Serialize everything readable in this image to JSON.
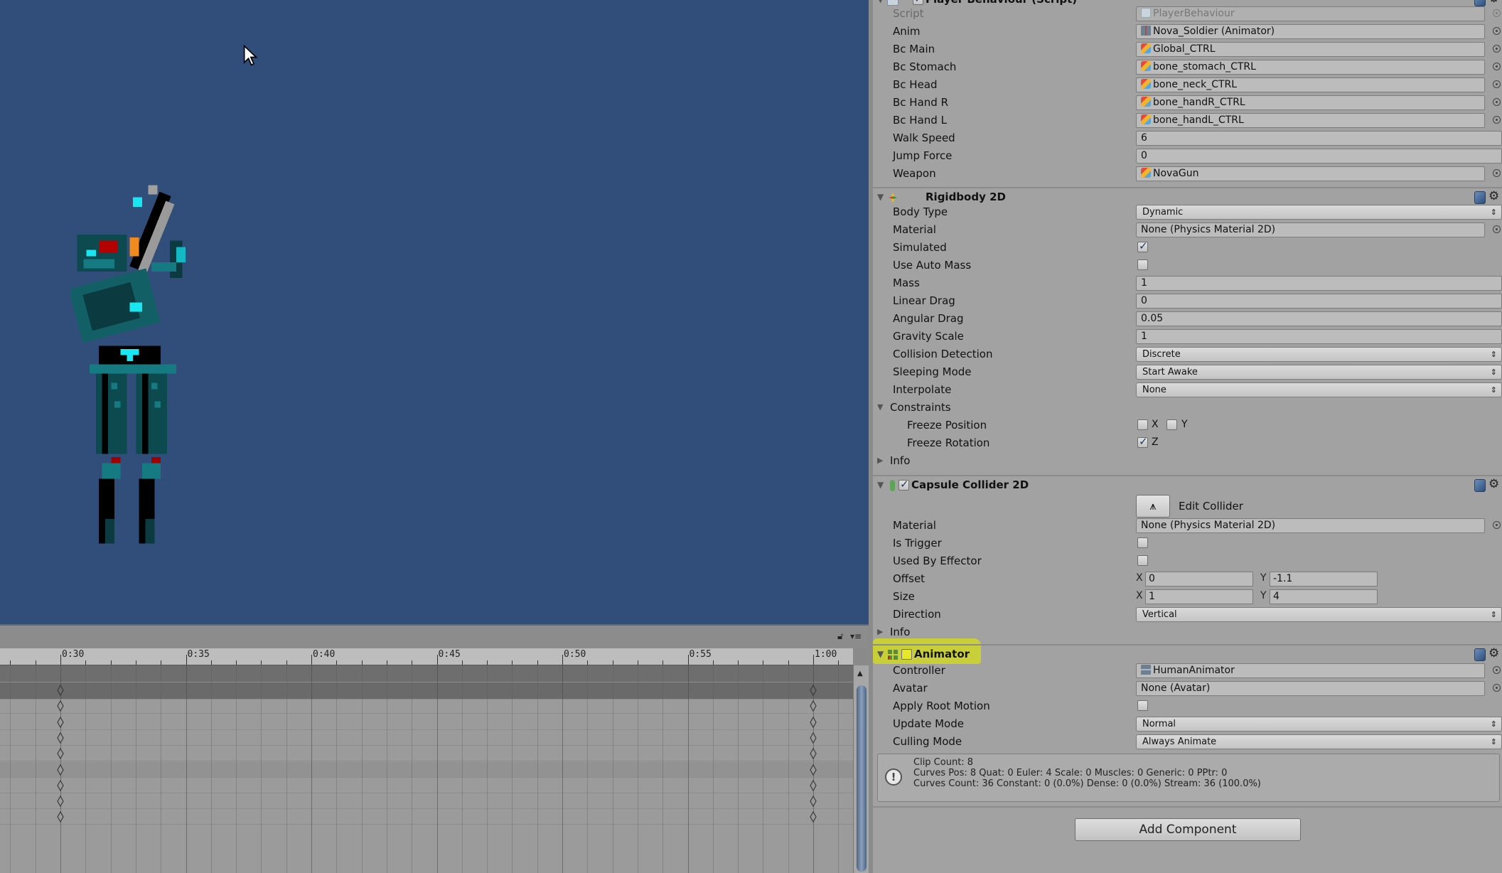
{
  "scene": {
    "background": "#304e79",
    "character": "Nova Soldier pixel sprite holding gun"
  },
  "timeline": {
    "ruler_labels": [
      "0:30",
      "0:35",
      "0:40",
      "0:45",
      "0:50",
      "0:55",
      "1:00"
    ],
    "keyframe_times": [
      "0:30",
      "1:00"
    ],
    "keyframe_rows": 9
  },
  "inspector": {
    "player_behaviour": {
      "title": "Player Behaviour (Script)",
      "props": [
        {
          "label": "Script",
          "value": "PlayerBehaviour",
          "icon": "script"
        },
        {
          "label": "Anim",
          "value": "Nova_Soldier (Animator)",
          "icon": "anim"
        },
        {
          "label": "Bc Main",
          "value": "Global_CTRL",
          "icon": "cube"
        },
        {
          "label": "Bc Stomach",
          "value": "bone_stomach_CTRL",
          "icon": "cube"
        },
        {
          "label": "Bc Head",
          "value": "bone_neck_CTRL",
          "icon": "cube"
        },
        {
          "label": "Bc Hand R",
          "value": "bone_handR_CTRL",
          "icon": "cube"
        },
        {
          "label": "Bc Hand L",
          "value": "bone_handL_CTRL",
          "icon": "cube"
        },
        {
          "label": "Walk Speed",
          "value": "6"
        },
        {
          "label": "Jump Force",
          "value": "0"
        },
        {
          "label": "Weapon",
          "value": "NovaGun",
          "icon": "cube"
        }
      ]
    },
    "rigidbody2d": {
      "title": "Rigidbody 2D",
      "body_type": {
        "label": "Body Type",
        "value": "Dynamic"
      },
      "material": {
        "label": "Material",
        "value": "None (Physics Material 2D)"
      },
      "simulated": {
        "label": "Simulated",
        "checked": true
      },
      "use_auto_mass": {
        "label": "Use Auto Mass",
        "checked": false
      },
      "mass": {
        "label": "Mass",
        "value": "1"
      },
      "linear_drag": {
        "label": "Linear Drag",
        "value": "0"
      },
      "angular_drag": {
        "label": "Angular Drag",
        "value": "0.05"
      },
      "gravity_scale": {
        "label": "Gravity Scale",
        "value": "1"
      },
      "collision_detection": {
        "label": "Collision Detection",
        "value": "Discrete"
      },
      "sleeping_mode": {
        "label": "Sleeping Mode",
        "value": "Start Awake"
      },
      "interpolate": {
        "label": "Interpolate",
        "value": "None"
      },
      "constraints": {
        "label": "Constraints"
      },
      "freeze_position": {
        "label": "Freeze Position",
        "x_label": "X",
        "x": false,
        "y_label": "Y",
        "y": false
      },
      "freeze_rotation": {
        "label": "Freeze Rotation",
        "z_label": "Z",
        "z": true
      },
      "info": {
        "label": "Info"
      }
    },
    "capsule_collider2d": {
      "title": "Capsule Collider 2D",
      "enabled": true,
      "edit_collider": "Edit Collider",
      "material": {
        "label": "Material",
        "value": "None (Physics Material 2D)"
      },
      "is_trigger": {
        "label": "Is Trigger",
        "checked": false
      },
      "used_by_effector": {
        "label": "Used By Effector",
        "checked": false
      },
      "offset": {
        "label": "Offset",
        "x_label": "X",
        "x": "0",
        "y_label": "Y",
        "y": "-1.1"
      },
      "size": {
        "label": "Size",
        "x_label": "X",
        "x": "1",
        "y_label": "Y",
        "y": "4"
      },
      "direction": {
        "label": "Direction",
        "value": "Vertical"
      },
      "info": {
        "label": "Info"
      }
    },
    "animator": {
      "title": "Animator",
      "enabled": false,
      "highlight_color": "#d6de14",
      "controller": {
        "label": "Controller",
        "value": "HumanAnimator"
      },
      "avatar": {
        "label": "Avatar",
        "value": "None (Avatar)"
      },
      "apply_root_motion": {
        "label": "Apply Root Motion",
        "checked": false
      },
      "update_mode": {
        "label": "Update Mode",
        "value": "Normal"
      },
      "culling_mode": {
        "label": "Culling Mode",
        "value": "Always Animate"
      },
      "info_lines": [
        "Clip Count: 8",
        "Curves Pos: 8 Quat: 0 Euler: 4 Scale: 0 Muscles: 0 Generic: 0 PPtr: 0",
        "Curves Count: 36 Constant: 0 (0.0%) Dense: 0 (0.0%) Stream: 36 (100.0%)"
      ]
    },
    "add_component": "Add Component"
  }
}
